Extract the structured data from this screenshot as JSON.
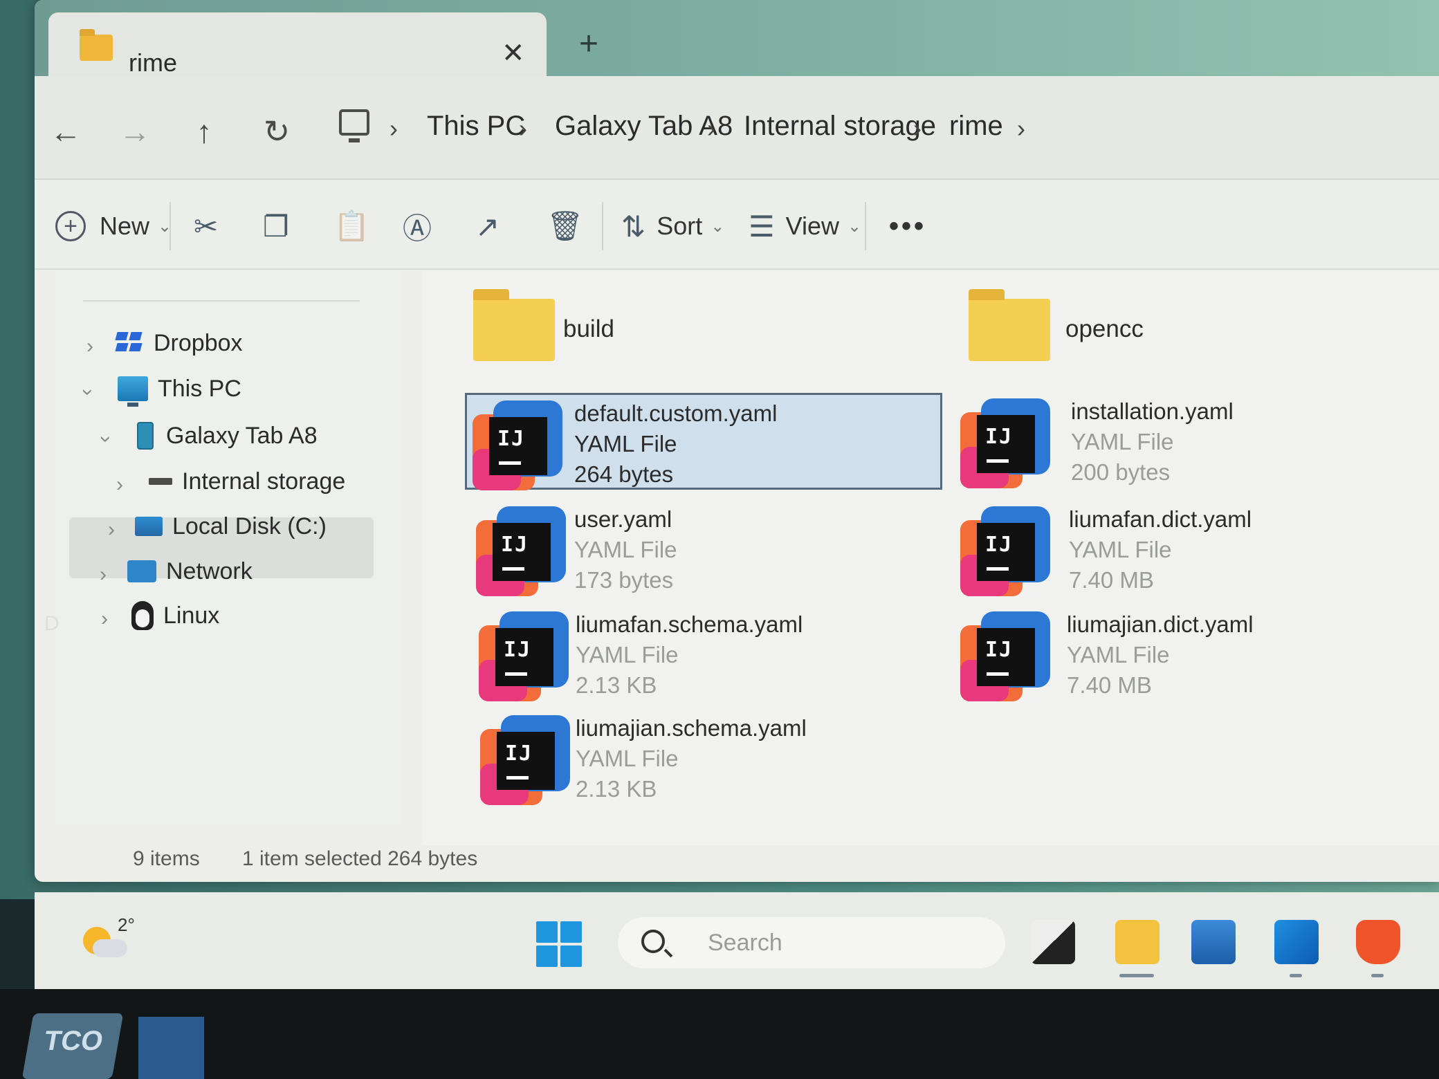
{
  "window": {
    "tab_title": "rime",
    "tab_close": "✕",
    "new_tab": "+"
  },
  "address": {
    "nav": {
      "back": "←",
      "forward": "→",
      "up": "↑",
      "refresh": "↻"
    },
    "separator": "›",
    "crumbs": [
      "This PC",
      "Galaxy Tab A8",
      "Internal storage",
      "rime"
    ]
  },
  "toolbar": {
    "new_label": "New",
    "sort_label": "Sort",
    "view_label": "View",
    "more_label": "•••"
  },
  "sidebar": {
    "items": [
      {
        "label": "Dropbox",
        "expanded": false
      },
      {
        "label": "This PC",
        "expanded": true
      },
      {
        "label": "Galaxy Tab A8",
        "expanded": true
      },
      {
        "label": "Internal storage",
        "expanded": false,
        "selected": true
      },
      {
        "label": "Local Disk (C:)",
        "expanded": false
      },
      {
        "label": "Network",
        "expanded": false
      },
      {
        "label": "Linux",
        "expanded": false
      }
    ]
  },
  "files": {
    "folders": [
      {
        "name": "build"
      },
      {
        "name": "opencc"
      }
    ],
    "items": [
      {
        "name": "default.custom.yaml",
        "type": "YAML File",
        "size": "264 bytes",
        "selected": true
      },
      {
        "name": "installation.yaml",
        "type": "YAML File",
        "size": "200 bytes"
      },
      {
        "name": "user.yaml",
        "type": "YAML File",
        "size": "173 bytes"
      },
      {
        "name": "liumafan.dict.yaml",
        "type": "YAML File",
        "size": "7.40 MB"
      },
      {
        "name": "liumafan.schema.yaml",
        "type": "YAML File",
        "size": "2.13 KB"
      },
      {
        "name": "liumajian.dict.yaml",
        "type": "YAML File",
        "size": "7.40 MB"
      },
      {
        "name": "liumajian.schema.yaml",
        "type": "YAML File",
        "size": "2.13 KB"
      }
    ],
    "icon_letters": "IJ"
  },
  "status": {
    "count": "9 items",
    "selection": "1 item selected  264 bytes"
  },
  "taskbar": {
    "weather_temp": "2°",
    "search_placeholder": "Search"
  },
  "bezel": {
    "logo_text": "TCO",
    "side_mark": "D"
  },
  "colors": {
    "folder": "#f5cf52",
    "selection_bg": "#cfe0ec",
    "accent_blue": "#2c78d4"
  }
}
